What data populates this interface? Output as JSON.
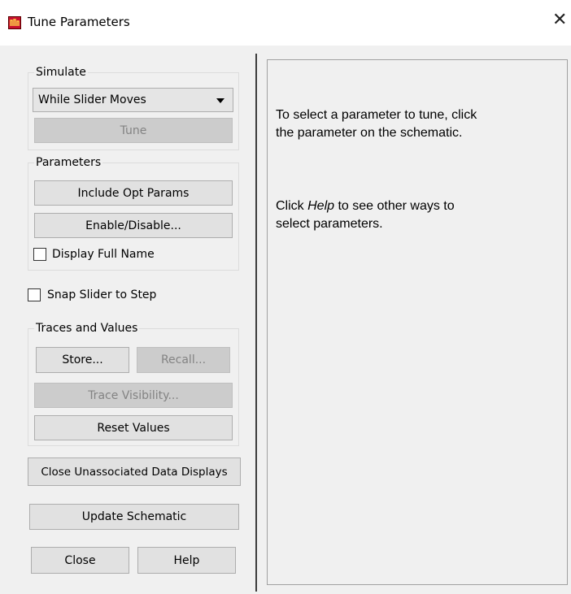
{
  "window": {
    "title": "Tune Parameters",
    "close_glyph": "✕",
    "icon": "app-logo-icon",
    "icon_color": "#c8102e"
  },
  "simulate": {
    "group_label": "Simulate",
    "mode_value": "While Slider Moves",
    "tune_label": "Tune"
  },
  "parameters": {
    "group_label": "Parameters",
    "include_opt_params_label": "Include Opt Params",
    "enable_disable_label": "Enable/Disable...",
    "display_full_name_label": "Display Full Name",
    "display_full_name_checked": false
  },
  "snap_slider": {
    "label": "Snap Slider to Step",
    "checked": false
  },
  "traces": {
    "group_label": "Traces and Values",
    "store_label": "Store...",
    "recall_label": "Recall...",
    "trace_visibility_label": "Trace Visibility...",
    "reset_values_label": "Reset Values"
  },
  "actions": {
    "close_unassociated_label": "Close Unassociated Data Displays",
    "update_schematic_label": "Update Schematic",
    "close_label": "Close",
    "help_label": "Help"
  },
  "info": {
    "line1": "To select a parameter to tune, click",
    "line2": "the parameter on the schematic.",
    "line3_prefix": "Click ",
    "line3_help": "Help",
    "line3_suffix": " to see other ways to",
    "line4": "select parameters."
  }
}
